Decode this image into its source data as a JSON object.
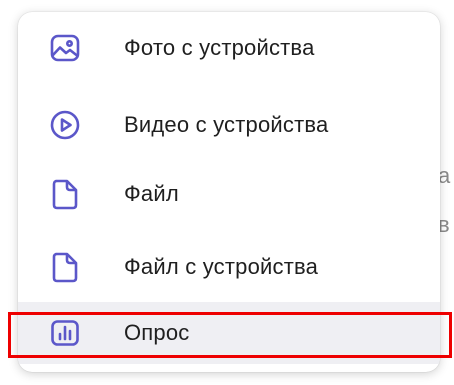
{
  "menu": {
    "items": [
      {
        "label": "Фото с устройства",
        "icon": "photo-icon"
      },
      {
        "label": "Видео с устройства",
        "icon": "video-play-icon"
      },
      {
        "label": "Файл",
        "icon": "file-icon"
      },
      {
        "label": "Файл с устройства",
        "icon": "file-icon"
      },
      {
        "label": "Опрос",
        "icon": "poll-chart-icon",
        "highlighted": true
      }
    ]
  },
  "background": {
    "glyphs": [
      "а",
      "в"
    ]
  },
  "colors": {
    "icon_accent": "#5b57c9",
    "label_text": "#1f1f1f",
    "highlight_border": "#ee0000",
    "selected_row_bg": "#efeff3"
  }
}
